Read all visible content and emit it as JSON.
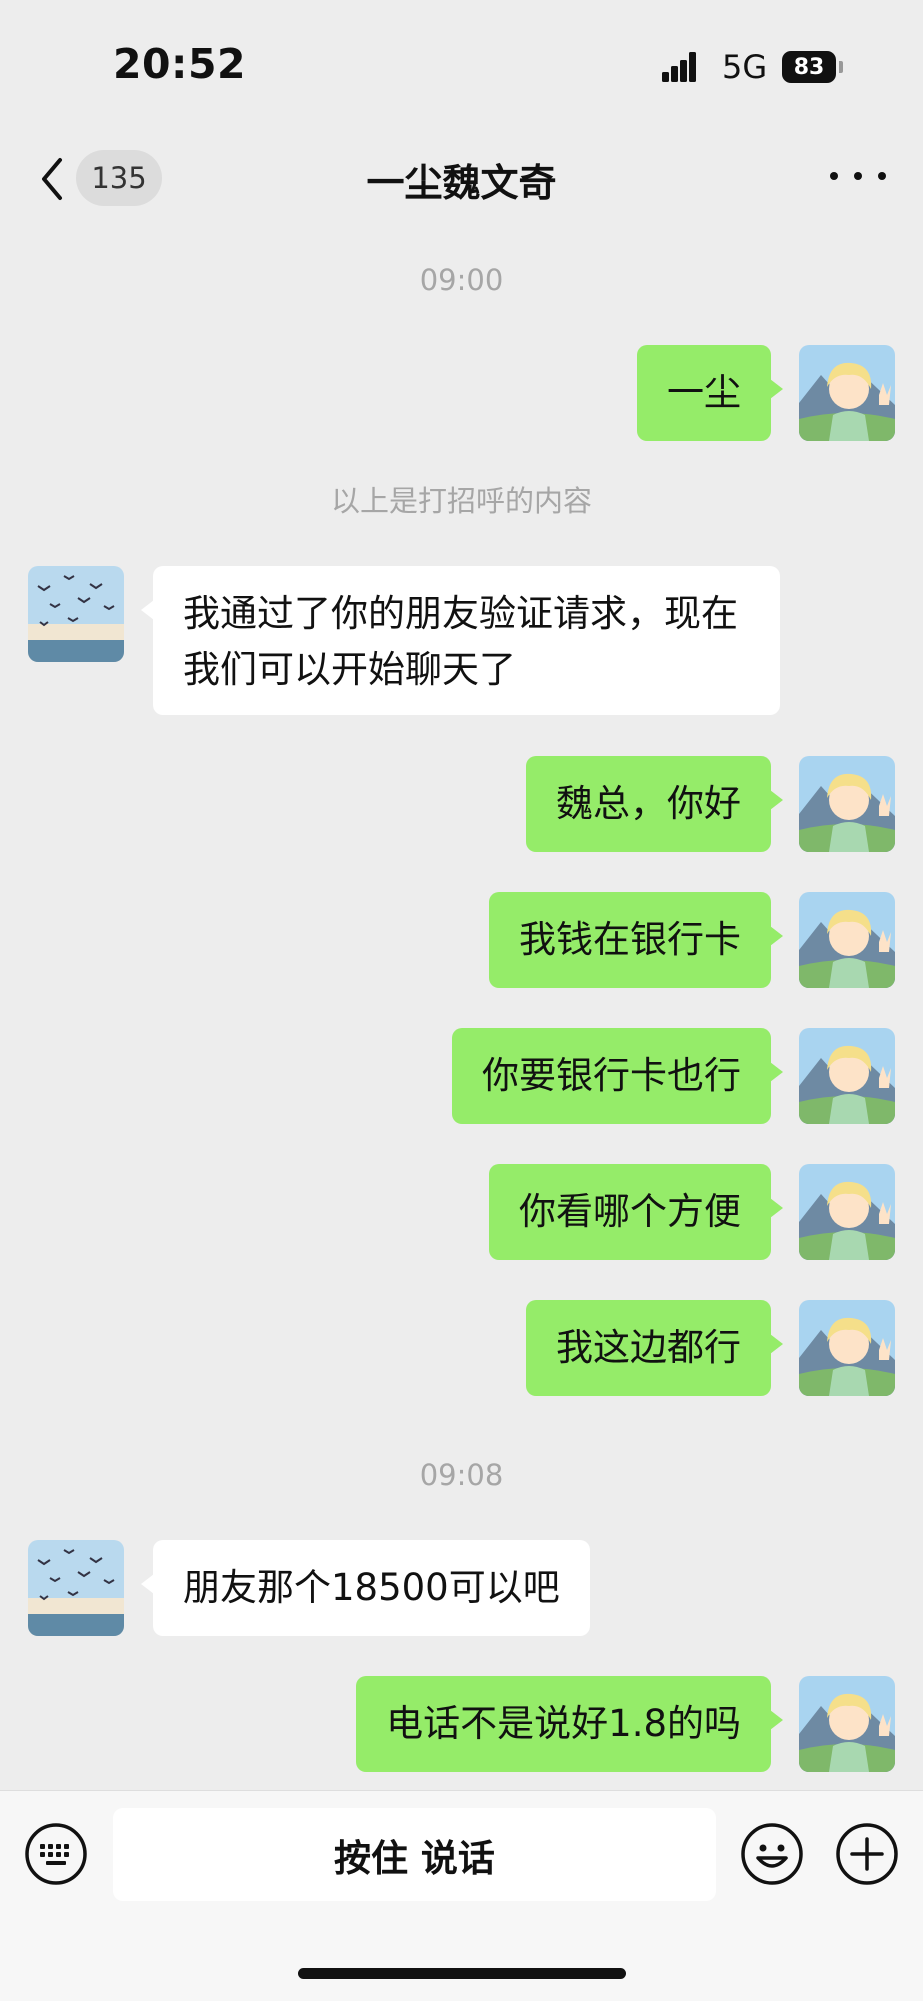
{
  "status_bar": {
    "time": "20:52",
    "network": "5G",
    "battery": "83"
  },
  "nav": {
    "unread_count": "135",
    "title": "一尘魏文奇"
  },
  "chat": {
    "time_1": "09:00",
    "msg_1": "一尘",
    "greeting_hint": "以上是打招呼的内容",
    "msg_2": "我通过了你的朋友验证请求，现在我们可以开始聊天了",
    "msg_3": "魏总，你好",
    "msg_4": "我钱在银行卡",
    "msg_5": "你要银行卡也行",
    "msg_6": "你看哪个方便",
    "msg_7": "我这边都行",
    "time_2": "09:08",
    "msg_8": "朋友那个18500可以吧",
    "msg_9": "电话不是说好1.8的吗"
  },
  "input_bar": {
    "voice_label": "按住 说话"
  },
  "colors": {
    "background": "#ededed",
    "my_bubble": "#95ec69",
    "other_bubble": "#ffffff",
    "timestamp": "#a6a6a6"
  },
  "icons": [
    "chevron-left-icon",
    "more-dots-icon",
    "keyboard-icon",
    "emoji-icon",
    "plus-icon"
  ]
}
